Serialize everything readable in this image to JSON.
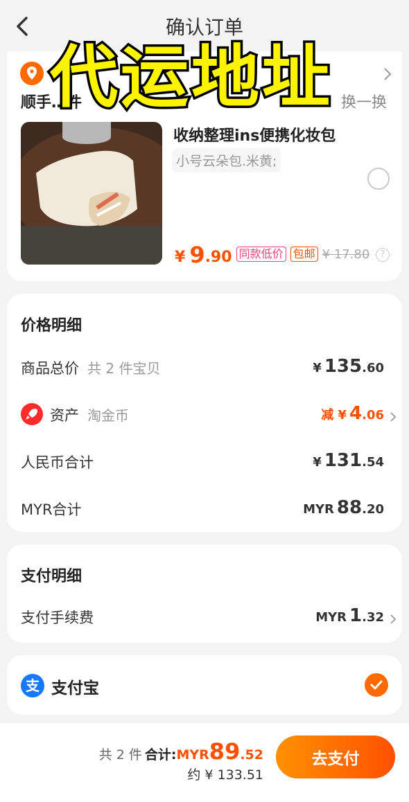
{
  "header": {
    "title": "确认订单"
  },
  "overlay": {
    "text": "代运地址"
  },
  "address": {
    "partial": "…",
    "seller_prefix": "顺手",
    "seller_suffix": "件",
    "change_label": "换一换"
  },
  "product": {
    "name": "收纳整理ins便携化妆包",
    "sku": "小号云朵包.米黄;",
    "currency": "¥",
    "price_int": "9",
    "price_dec": ".90",
    "tag_low_price": "同款低价",
    "tag_free_ship": "包邮",
    "old_price": "¥ 17.80",
    "help": "?"
  },
  "price_detail": {
    "title": "价格明细",
    "goods_total": {
      "label": "商品总价",
      "sub": "共 2 件宝贝",
      "sym": "¥",
      "int": "135",
      "dec": ".60"
    },
    "assets": {
      "label": "资产",
      "sub": "淘金币",
      "sym": "减 ¥",
      "int": "4",
      "dec": ".06"
    },
    "rmb_total": {
      "label": "人民币合计",
      "sym": "¥",
      "int": "131",
      "dec": ".54"
    },
    "myr_total": {
      "label": "MYR合计",
      "sym": "MYR",
      "int": "88",
      "dec": ".20"
    }
  },
  "payment_detail": {
    "title": "支付明细",
    "fee": {
      "label": "支付手续费",
      "sym": "MYR",
      "int": "1",
      "dec": ".32"
    }
  },
  "alipay": {
    "label": "支付宝"
  },
  "bottom_bar": {
    "count": "共 2 件",
    "total_label": "合计:",
    "currency": "MYR",
    "int": "89",
    "dec": ".52",
    "approx": "约 ¥ 133.51",
    "pay_label": "去支付"
  },
  "colors": {
    "accent": "#ff5000",
    "pink_tag": "#f0437a",
    "alipay_blue": "#1677ff",
    "overlay_yellow": "#fbf300"
  }
}
